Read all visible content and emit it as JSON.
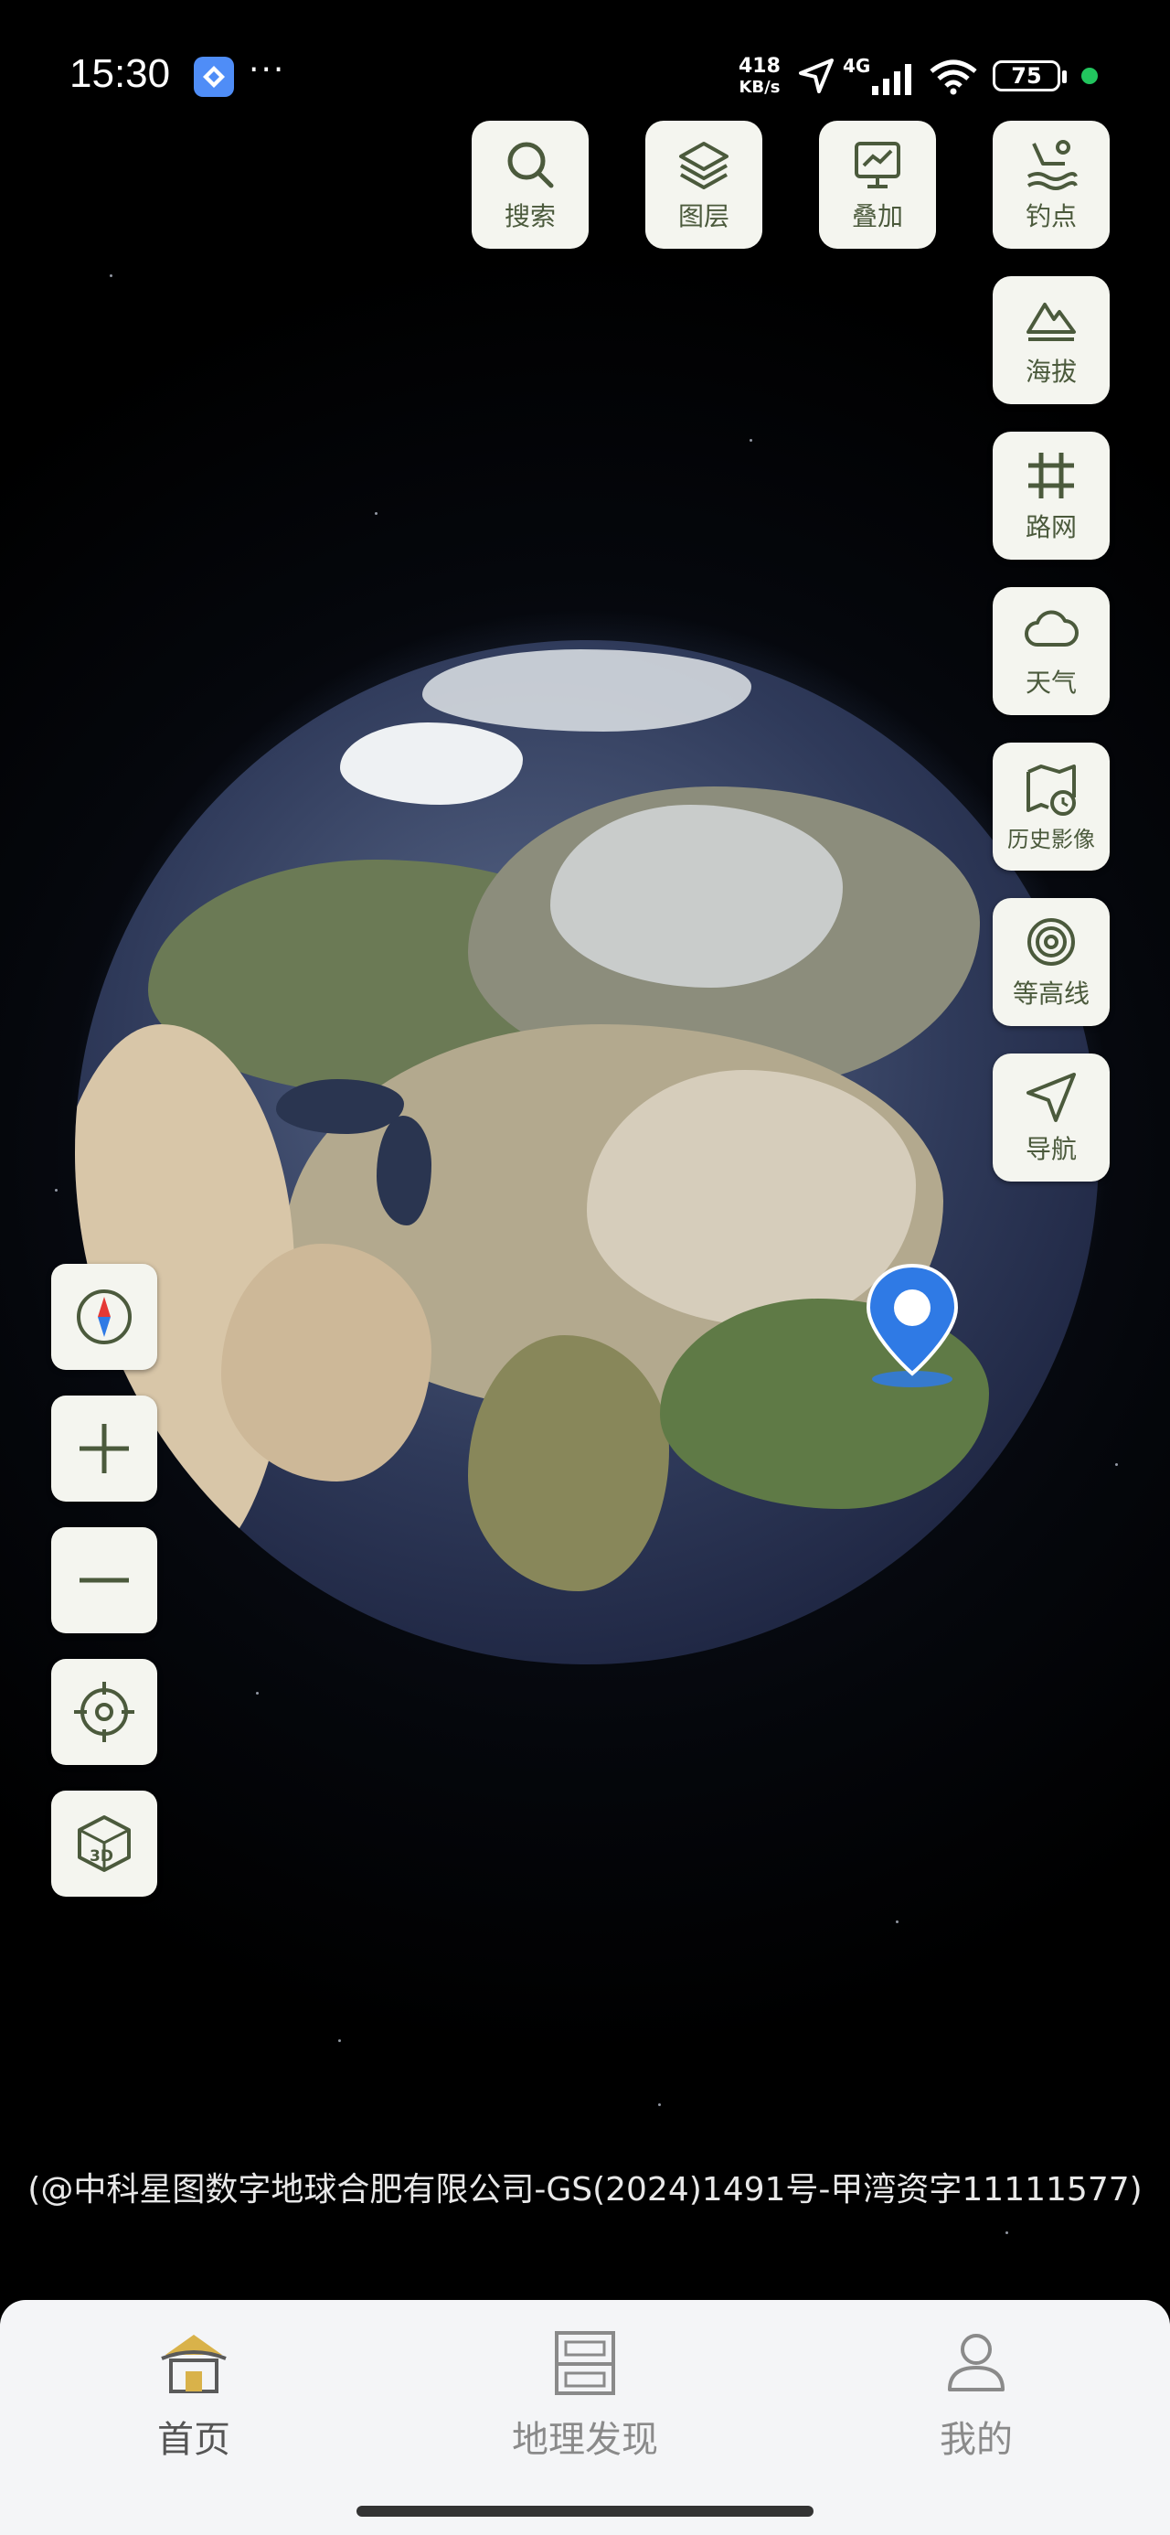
{
  "status_bar": {
    "time": "15:30",
    "more": "···",
    "speed_value": "418",
    "speed_unit": "KB/s",
    "network": "4G",
    "battery": "75"
  },
  "right_controls": [
    {
      "label": "搜索",
      "icon": "search-icon"
    },
    {
      "label": "图层",
      "icon": "layers-icon"
    },
    {
      "label": "叠加",
      "icon": "overlay-icon"
    },
    {
      "label": "钓点",
      "icon": "fishing-spot-icon"
    },
    {
      "label": "海拔",
      "icon": "altitude-icon"
    },
    {
      "label": "路网",
      "icon": "road-network-icon"
    },
    {
      "label": "天气",
      "icon": "weather-icon"
    },
    {
      "label": "历史影像",
      "icon": "history-imagery-icon"
    },
    {
      "label": "等高线",
      "icon": "contour-icon"
    },
    {
      "label": "导航",
      "icon": "navigation-icon"
    }
  ],
  "left_controls": [
    {
      "name": "compass",
      "icon": "compass-icon"
    },
    {
      "name": "zoom-in",
      "icon": "plus-icon"
    },
    {
      "name": "zoom-out",
      "icon": "minus-icon"
    },
    {
      "name": "locate",
      "icon": "locate-icon"
    },
    {
      "name": "3d-view",
      "icon": "3d-cube-icon",
      "text": "3D"
    }
  ],
  "copyright": "(@中科星图数字地球合肥有限公司-GS(2024)1491号-甲湾资字11111577)",
  "tabs": [
    {
      "label": "首页",
      "icon": "home-icon",
      "active": true
    },
    {
      "label": "地理发现",
      "icon": "discover-icon",
      "active": false
    },
    {
      "label": "我的",
      "icon": "profile-icon",
      "active": false
    }
  ],
  "colors": {
    "button_bg": "#f4f5ef",
    "icon_color": "#4b5a3c",
    "pin_blue": "#2f7ae5",
    "tabbar_bg": "#f4f5f7",
    "home_icon_gold": "#d9b24a"
  }
}
